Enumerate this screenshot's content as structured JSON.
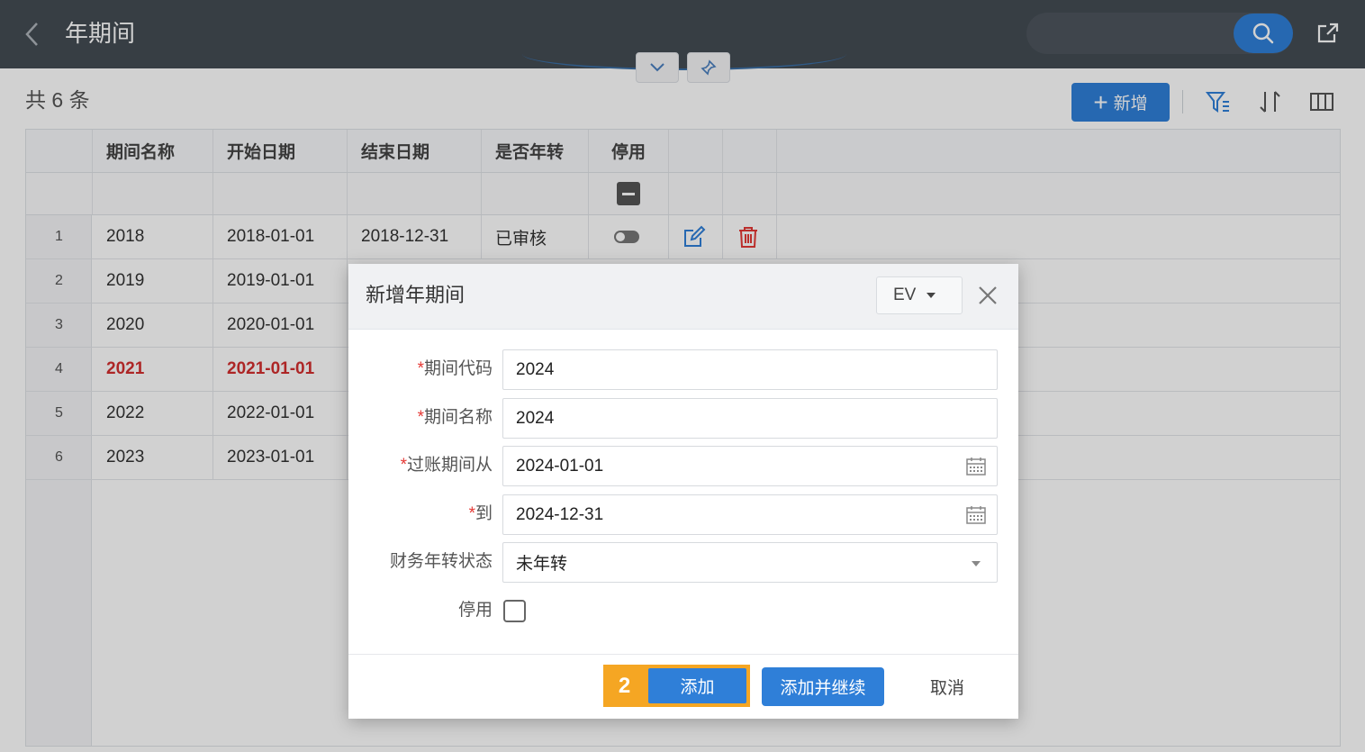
{
  "header": {
    "title": "年期间",
    "back_icon": "chevron-left-icon",
    "search_icon": "search-icon",
    "share_icon": "external-link-icon"
  },
  "toolbar": {
    "count_text": "共 6 条",
    "add_new_label": "新增",
    "icons": [
      "filter-icon",
      "sort-icon",
      "columns-icon"
    ]
  },
  "table": {
    "columns": [
      "期间名称",
      "开始日期",
      "结束日期",
      "是否年转",
      "停用"
    ],
    "rows": [
      {
        "num": "1",
        "name": "2018",
        "start": "2018-01-01",
        "end": "2018-12-31",
        "status": "已审核"
      },
      {
        "num": "2",
        "name": "2019",
        "start": "2019-01-01"
      },
      {
        "num": "3",
        "name": "2020",
        "start": "2020-01-01"
      },
      {
        "num": "4",
        "name": "2021",
        "start": "2021-01-01"
      },
      {
        "num": "5",
        "name": "2022",
        "start": "2022-01-01"
      },
      {
        "num": "6",
        "name": "2023",
        "start": "2023-01-01"
      }
    ]
  },
  "dialog": {
    "title": "新增年期间",
    "lang": "EV",
    "fields": {
      "code": {
        "label": "期间代码",
        "required_mark": "*",
        "value": "2024"
      },
      "name": {
        "label": "期间名称",
        "required_mark": "*",
        "value": "2024"
      },
      "from": {
        "label": "过账期间从",
        "required_mark": "*",
        "value": "2024-01-01"
      },
      "to": {
        "label": "到",
        "required_mark": "*",
        "value": "2024-12-31"
      },
      "status": {
        "label": "财务年转状态",
        "value": "未年转"
      },
      "disabled": {
        "label": "停用"
      }
    },
    "step_number": "2",
    "buttons": {
      "add": "添加",
      "add_continue": "添加并继续",
      "cancel": "取消"
    }
  },
  "colors": {
    "primary": "#2f7fd8",
    "header_bg": "#444c54",
    "highlight": "#f5a623",
    "error_red": "#d32f2f"
  }
}
